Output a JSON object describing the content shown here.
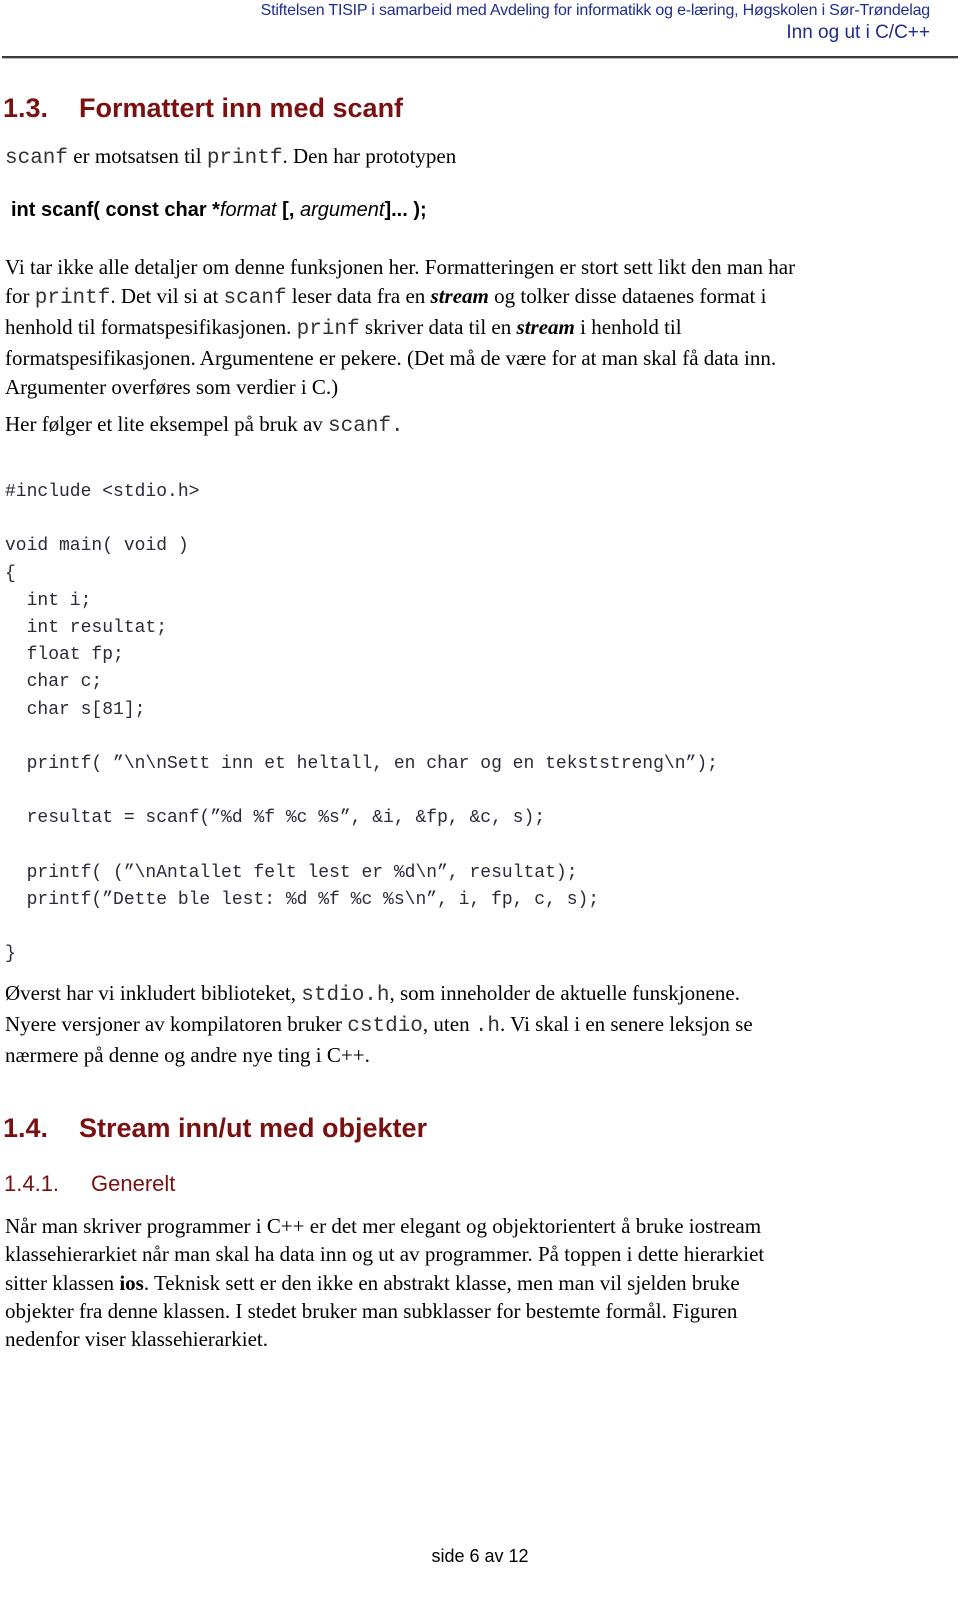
{
  "header": {
    "institution": "Stiftelsen TISIP i samarbeid med Avdeling for informatikk og e-læring, Høgskolen i Sør-Trøndelag",
    "doc_title": "Inn og ut i C/C++"
  },
  "section_1_3": {
    "number": "1.3.",
    "title": "Formattert inn med scanf",
    "intro": {
      "code1": "scanf",
      "text1": " er motsatsen til ",
      "code2": "printf",
      "text2": ". Den har prototypen"
    },
    "prototype": {
      "part1": "int scanf( const char *",
      "italic1": "format",
      "part2": " [, ",
      "italic2": "argument",
      "part3": "]... );"
    },
    "para1": {
      "line1": "Vi tar ikke alle detaljer om denne funksjonen her. Formatteringen er stort sett likt den man har",
      "line2_a": "for ",
      "line2_code1": "printf",
      "line2_b": ". Det vil si at ",
      "line2_code2": "scanf",
      "line2_c": " leser data fra en ",
      "line2_bold": "stream",
      "line2_d": " og tolker disse dataenes format i",
      "line3_a": "henhold til formatspesifikasjonen. ",
      "line3_code": "prinf",
      "line3_b": " skriver data til en ",
      "line3_bold": "stream",
      "line3_c": " i henhold til",
      "line4": "formatspesifikasjonen. Argumentene er pekere. (Det må de være for at man skal få data inn.",
      "line5": "Argumenter overføres som verdier i C.)"
    },
    "para2": {
      "text": "Her følger et lite eksempel på bruk av ",
      "code": "scanf."
    },
    "code_lines": [
      "#include <stdio.h>",
      "",
      "void main( void )",
      "{",
      "  int i;",
      "  int resultat;",
      "  float fp;",
      "  char c;",
      "  char s[81];",
      "",
      "  printf( ”\\n\\nSett inn et heltall, en char og en tekststreng\\n”);",
      "",
      "  resultat = scanf(”%d %f %c %s”, &i, &fp, &c, s);",
      "",
      "  printf( (”\\nAntallet felt lest er %d\\n”, resultat);",
      "  printf(”Dette ble lest: %d %f %c %s\\n”, i, fp, c, s);",
      "",
      "}"
    ],
    "para3": {
      "line1_a": "Øverst har vi inkludert biblioteket, ",
      "line1_code": "stdio.h",
      "line1_b": ",  som inneholder de aktuelle funskjonene.",
      "line2_a": "Nyere versjoner av kompilatoren bruker ",
      "line2_code1": "cstdio",
      "line2_b": ", uten ",
      "line2_code2": ".h",
      "line2_c": ". Vi skal i en senere leksjon se",
      "line3": "nærmere på denne og andre nye ting i C++."
    }
  },
  "section_1_4": {
    "number": "1.4.",
    "title": "Stream inn/ut med objekter",
    "sub": {
      "number": "1.4.1.",
      "title": "Generelt"
    },
    "para": {
      "line1": "Når man skriver programmer i C++ er det mer elegant og objektorientert å bruke iostream",
      "line2": "klassehierarkiet når man skal ha data inn og ut av programmer. På toppen i dette hierarkiet",
      "line3_a": "sitter klassen ",
      "line3_bold": "ios",
      "line3_b": ". Teknisk sett er den ikke en abstrakt klasse, men man vil sjelden bruke",
      "line4": "objekter fra denne klassen. I stedet bruker man subklasser for bestemte formål. Figuren",
      "line5": "nedenfor viser klassehierarkiet."
    }
  },
  "footer": {
    "page_label": "side 6 av 12"
  }
}
